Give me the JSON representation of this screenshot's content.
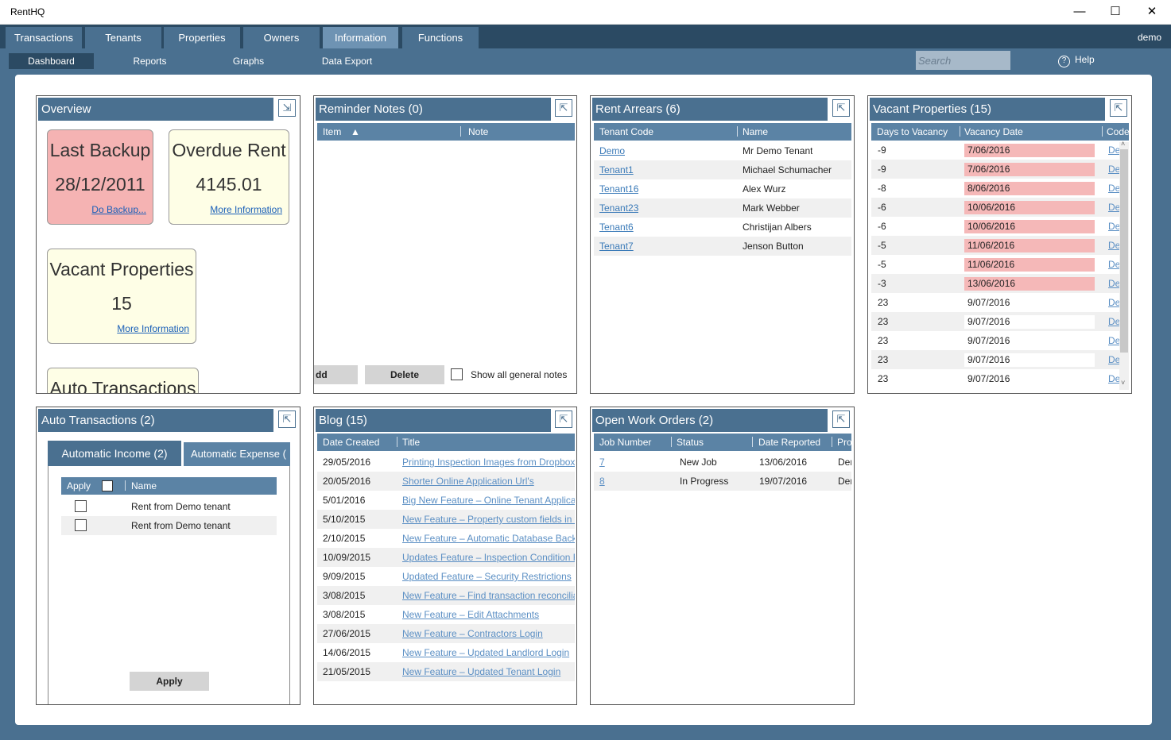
{
  "window": {
    "title": "RentHQ",
    "minimize": "—",
    "maximize": "☐",
    "close": "✕"
  },
  "menu": {
    "tabs": [
      "Transactions",
      "Tenants",
      "Properties",
      "Owners",
      "Information",
      "Functions"
    ],
    "active": "Information",
    "user": "demo"
  },
  "subnav": {
    "tabs": [
      "Dashboard",
      "Reports",
      "Graphs",
      "Data Export"
    ],
    "active": "Dashboard",
    "search_placeholder": "Search",
    "help": "Help",
    "help_icon": "?"
  },
  "overview": {
    "title": "Overview",
    "expand_icon": "⇲",
    "last_backup": {
      "title": "Last Backup",
      "value": "28/12/2011",
      "link": "Do Backup...",
      "color": "#f5b3b3"
    },
    "overdue_rent": {
      "title": "Overdue Rent",
      "value": "4145.01",
      "link": "More Information",
      "color": "#fefee6"
    },
    "vacant": {
      "title": "Vacant Properties",
      "value": "15",
      "link": "More Information",
      "color": "#fefee6"
    },
    "auto": {
      "title": "Auto Transactions"
    }
  },
  "reminder": {
    "title": "Reminder Notes (0)",
    "expand_icon": "⇱",
    "col_item": "Item",
    "sort_icon": "▲",
    "col_note": "Note",
    "add": "dd",
    "delete": "Delete",
    "show_all": "Show all general notes"
  },
  "arrears": {
    "title": "Rent Arrears (6)",
    "expand_icon": "⇱",
    "col_code": "Tenant Code",
    "col_name": "Name",
    "rows": [
      {
        "code": "Demo",
        "name": "Mr Demo Tenant"
      },
      {
        "code": "Tenant1",
        "name": "Michael Schumacher"
      },
      {
        "code": "Tenant16",
        "name": "Alex Wurz"
      },
      {
        "code": "Tenant23",
        "name": "Mark Webber"
      },
      {
        "code": "Tenant6",
        "name": "Christijan Albers"
      },
      {
        "code": "Tenant7",
        "name": "Jenson Button"
      }
    ]
  },
  "vacant": {
    "title": "Vacant Properties (15)",
    "expand_icon": "⇱",
    "col_days": "Days to Vacancy",
    "col_date": "Vacancy Date",
    "col_code": "Code",
    "rows": [
      {
        "days": "-9",
        "date": "7/06/2016",
        "code": "De",
        "late": true
      },
      {
        "days": "-9",
        "date": "7/06/2016",
        "code": "De",
        "late": true
      },
      {
        "days": "-8",
        "date": "8/06/2016",
        "code": "De",
        "late": true
      },
      {
        "days": "-6",
        "date": "10/06/2016",
        "code": "De",
        "late": true
      },
      {
        "days": "-6",
        "date": "10/06/2016",
        "code": "De",
        "late": true
      },
      {
        "days": "-5",
        "date": "11/06/2016",
        "code": "De",
        "late": true
      },
      {
        "days": "-5",
        "date": "11/06/2016",
        "code": "De",
        "late": true
      },
      {
        "days": "-3",
        "date": "13/06/2016",
        "code": "De",
        "late": true
      },
      {
        "days": "23",
        "date": "9/07/2016",
        "code": "De",
        "late": false
      },
      {
        "days": "23",
        "date": "9/07/2016",
        "code": "De",
        "late": false
      },
      {
        "days": "23",
        "date": "9/07/2016",
        "code": "De",
        "late": false
      },
      {
        "days": "23",
        "date": "9/07/2016",
        "code": "De",
        "late": false
      },
      {
        "days": "23",
        "date": "9/07/2016",
        "code": "De",
        "late": false
      }
    ],
    "scroll_up": "˄",
    "scroll_down": "˅"
  },
  "auto": {
    "title": "Auto Transactions (2)",
    "expand_icon": "⇱",
    "tab_income": "Automatic Income (2)",
    "tab_expense": "Automatic Expense (",
    "col_apply": "Apply",
    "col_name": "Name",
    "rows": [
      {
        "name": "Rent from Demo tenant"
      },
      {
        "name": "Rent from Demo tenant"
      }
    ],
    "apply_button": "Apply"
  },
  "blog": {
    "title": "Blog (15)",
    "expand_icon": "⇱",
    "col_date": "Date Created",
    "col_title": "Title",
    "rows": [
      {
        "date": "29/05/2016",
        "title": "Printing Inspection Images from Dropbox"
      },
      {
        "date": "20/05/2016",
        "title": "Shorter Online Application Url's"
      },
      {
        "date": "5/01/2016",
        "title": "Big New Feature – Online Tenant Applica"
      },
      {
        "date": "5/10/2015",
        "title": "New Feature – Property custom fields in t"
      },
      {
        "date": "2/10/2015",
        "title": "New Feature – Automatic Database Backu"
      },
      {
        "date": "10/09/2015",
        "title": "Updates Feature – Inspection Condition F"
      },
      {
        "date": "9/09/2015",
        "title": "Updated Feature – Security Restrictions"
      },
      {
        "date": "3/08/2015",
        "title": "New Feature – Find transaction reconcilia"
      },
      {
        "date": "3/08/2015",
        "title": "New Feature – Edit Attachments"
      },
      {
        "date": "27/06/2015",
        "title": "New Feature – Contractors Login"
      },
      {
        "date": "14/06/2015",
        "title": "New Feature – Updated Landlord Login"
      },
      {
        "date": "21/05/2015",
        "title": "New Feature – Updated Tenant Login"
      }
    ]
  },
  "workorders": {
    "title": "Open Work Orders (2)",
    "expand_icon": "⇱",
    "col_job": "Job Number",
    "col_status": "Status",
    "col_date": "Date Reported",
    "col_pro": "Pro",
    "rows": [
      {
        "job": "7",
        "status": "New Job",
        "date": "13/06/2016",
        "pro": "Der"
      },
      {
        "job": "8",
        "status": "In Progress",
        "date": "19/07/2016",
        "pro": "Der"
      }
    ]
  }
}
